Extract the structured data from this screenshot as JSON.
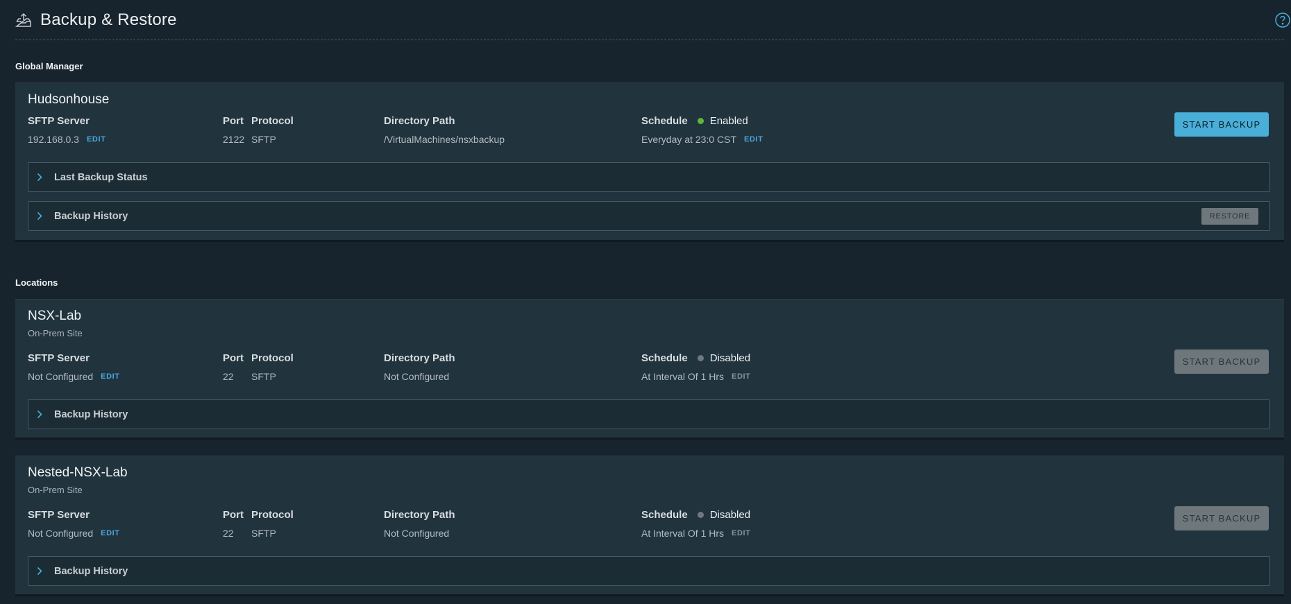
{
  "header": {
    "title": "Backup & Restore"
  },
  "global_manager": {
    "section_label": "Global Manager",
    "name": "Hudsonhouse",
    "sftp_label": "SFTP Server",
    "sftp_value": "192.168.0.3",
    "port_label": "Port",
    "port_value": "2122",
    "protocol_label": "Protocol",
    "protocol_value": "SFTP",
    "dir_label": "Directory Path",
    "dir_value": "/VirtualMachines/nsxbackup",
    "schedule_label": "Schedule",
    "schedule_status": "Enabled",
    "schedule_value": "Everyday at 23:0 CST",
    "edit_label": "EDIT",
    "start_backup_label": "START BACKUP",
    "last_backup_status_label": "Last Backup Status",
    "backup_history_label": "Backup History",
    "restore_label": "RESTORE"
  },
  "locations": {
    "section_label": "Locations",
    "sites": [
      {
        "name": "NSX-Lab",
        "subtitle": "On-Prem Site",
        "sftp_label": "SFTP Server",
        "sftp_value": "Not Configured",
        "port_label": "Port",
        "port_value": "22",
        "protocol_label": "Protocol",
        "protocol_value": "SFTP",
        "dir_label": "Directory Path",
        "dir_value": "Not Configured",
        "schedule_label": "Schedule",
        "schedule_status": "Disabled",
        "schedule_value": "At Interval Of 1 Hrs",
        "edit_label": "EDIT",
        "start_backup_label": "START BACKUP",
        "backup_history_label": "Backup History"
      },
      {
        "name": "Nested-NSX-Lab",
        "subtitle": "On-Prem Site",
        "sftp_label": "SFTP Server",
        "sftp_value": "Not Configured",
        "port_label": "Port",
        "port_value": "22",
        "protocol_label": "Protocol",
        "protocol_value": "SFTP",
        "dir_label": "Directory Path",
        "dir_value": "Not Configured",
        "schedule_label": "Schedule",
        "schedule_status": "Disabled",
        "schedule_value": "At Interval Of 1 Hrs",
        "edit_label": "EDIT",
        "start_backup_label": "START BACKUP",
        "backup_history_label": "Backup History"
      }
    ]
  },
  "colors": {
    "background": "#17242d",
    "card": "#21333d",
    "accent": "#49afd9",
    "link": "#4aa8e0",
    "enabled": "#5fb63b",
    "disabled": "#6f7a80"
  },
  "icons": {
    "title": "backup-tray-icon",
    "help": "help-circle-icon",
    "expander": "chevron-right-icon",
    "status": "status-dot-icon"
  }
}
